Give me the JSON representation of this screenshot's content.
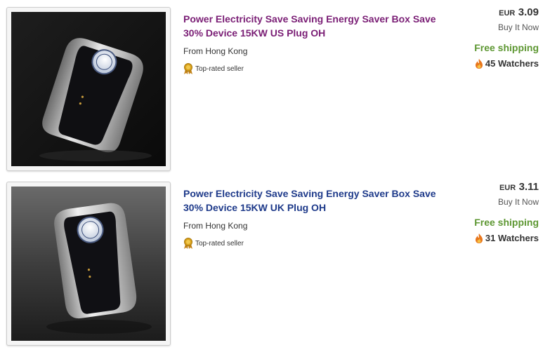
{
  "listings": [
    {
      "title": "Power Electricity Save Saving Energy Saver Box Save 30% Device 15KW US Plug OH",
      "title_color": "#7a1e75",
      "location": "From Hong Kong",
      "badge": "Top-rated seller",
      "currency": "EUR",
      "price": "3.09",
      "format": "Buy It Now",
      "shipping": "Free shipping",
      "watchers": "45 Watchers",
      "image_icon": "energy-saver-plug-icon",
      "image_background": "dark"
    },
    {
      "title": "Power Electricity Save Saving Energy Saver Box Save 30% Device 15KW UK Plug OH",
      "title_color": "#1e3a8a",
      "location": "From Hong Kong",
      "badge": "Top-rated seller",
      "currency": "EUR",
      "price": "3.11",
      "format": "Buy It Now",
      "shipping": "Free shipping",
      "watchers": "31 Watchers",
      "image_icon": "energy-saver-plug-icon",
      "image_background": "gradient-grey"
    }
  ],
  "colors": {
    "shipping_green": "#5d9732",
    "flame_orange": "#e8761d",
    "medal_gold": "#d9a21c"
  }
}
